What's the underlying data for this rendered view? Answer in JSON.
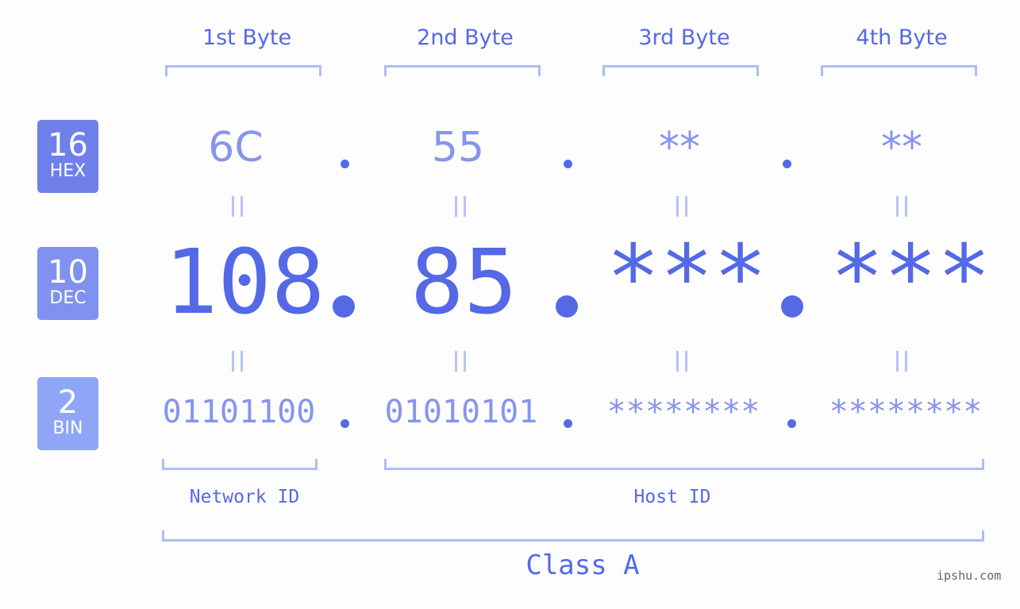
{
  "headers": [
    "1st Byte",
    "2nd Byte",
    "3rd Byte",
    "4th Byte"
  ],
  "bases": [
    {
      "num": "16",
      "name": "HEX",
      "color": "#6f80ea"
    },
    {
      "num": "10",
      "name": "DEC",
      "color": "#8091f0"
    },
    {
      "num": "2",
      "name": "BIN",
      "color": "#8fa5f7"
    }
  ],
  "hex": [
    "6C",
    "55",
    "**",
    "**"
  ],
  "dec": [
    "108",
    "85",
    "***",
    "***"
  ],
  "bin": [
    "01101100",
    "01010101",
    "********",
    "********"
  ],
  "labels": {
    "network_id": "Network ID",
    "host_id": "Host ID",
    "class": "Class A"
  },
  "watermark": "ipshu.com",
  "colors": {
    "accent": "#5469e6",
    "light": "#8794ee",
    "bracket": "#b1bbf6"
  }
}
